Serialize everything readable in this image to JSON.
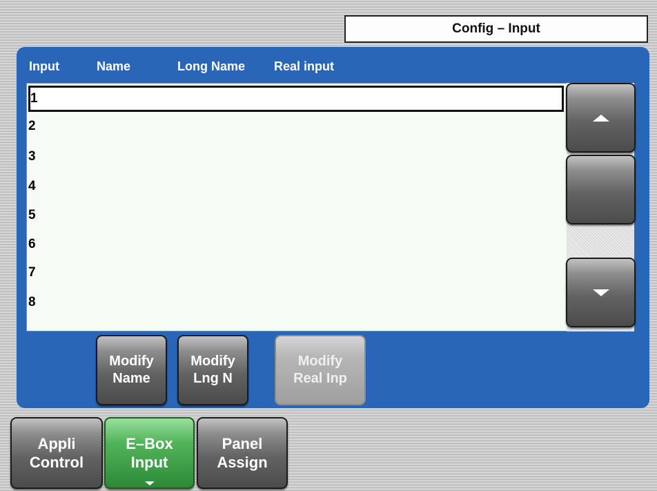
{
  "title": "Config – Input",
  "columns": [
    "Input",
    "Name",
    "Long Name",
    "Real input"
  ],
  "rows": [
    {
      "input": "1",
      "selected": true
    },
    {
      "input": "2",
      "selected": false
    },
    {
      "input": "3",
      "selected": false
    },
    {
      "input": "4",
      "selected": false
    },
    {
      "input": "5",
      "selected": false
    },
    {
      "input": "6",
      "selected": false
    },
    {
      "input": "7",
      "selected": false
    },
    {
      "input": "8",
      "selected": false
    }
  ],
  "scroll": {
    "up_icon": "triangle-up-icon",
    "down_icon": "triangle-down-icon"
  },
  "actions": {
    "modify_name": "Modify\nName",
    "modify_lng_n": "Modify\nLng N",
    "modify_real_inp": "Modify\nReal Inp"
  },
  "tabs": [
    {
      "label": "Appli\nControl",
      "active": false
    },
    {
      "label": "E–Box\nInput",
      "active": true
    },
    {
      "label": "Panel\nAssign",
      "active": false
    }
  ],
  "colors": {
    "panel_blue": "#2a66b8",
    "active_tab_green": "#52b45a",
    "list_background": "#f6fbf6"
  }
}
